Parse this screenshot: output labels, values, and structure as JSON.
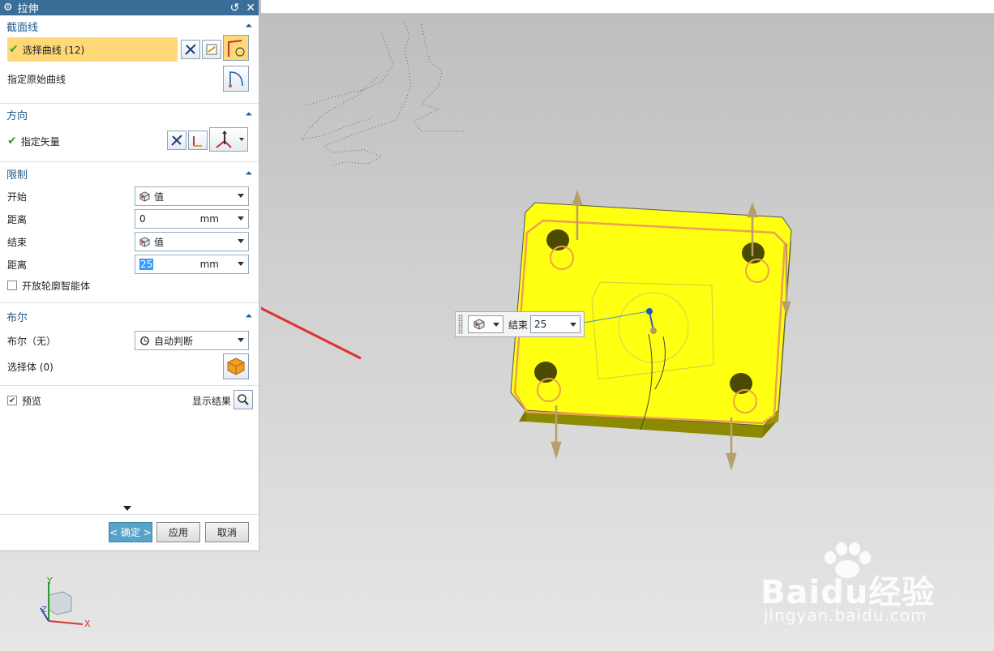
{
  "dialog": {
    "title": "拉伸",
    "sections": {
      "section": {
        "header": "截面线",
        "select_curve": "选择曲线 (12)",
        "specify_origin_curve": "指定原始曲线"
      },
      "direction": {
        "header": "方向",
        "specify_vector": "指定矢量"
      },
      "limits": {
        "header": "限制",
        "start_label": "开始",
        "start_value": "值",
        "distance_label_1": "距离",
        "distance_value_1": "0",
        "distance_unit_1": "mm",
        "end_label": "结束",
        "end_value": "值",
        "distance_label_2": "距离",
        "distance_value_2": "25",
        "distance_unit_2": "mm",
        "open_profile_label": "开放轮廓智能体"
      },
      "boolean": {
        "header": "布尔",
        "boolean_label": "布尔（无）",
        "boolean_value": "自动判断",
        "select_body": "选择体 (0)"
      }
    },
    "preview_label": "预览",
    "show_result_label": "显示结果",
    "buttons": {
      "ok": "< 确定 >",
      "apply": "应用",
      "cancel": "取消"
    }
  },
  "floating_handle": {
    "label": "结束",
    "value": "25"
  },
  "triad": {
    "x": "X",
    "y": "Y",
    "z": "Z"
  },
  "watermark": {
    "brand": "Baidu经验",
    "url": "jingyan.baidu.com"
  },
  "colors": {
    "title_bar": "#3a6e98",
    "section_header_text": "#1f5a8a",
    "selected_row": "#ffd877",
    "part_face": "#ffff12",
    "part_side": "#8a8a00",
    "edge_highlight": "#f0a050",
    "arrow": "#e03030"
  }
}
